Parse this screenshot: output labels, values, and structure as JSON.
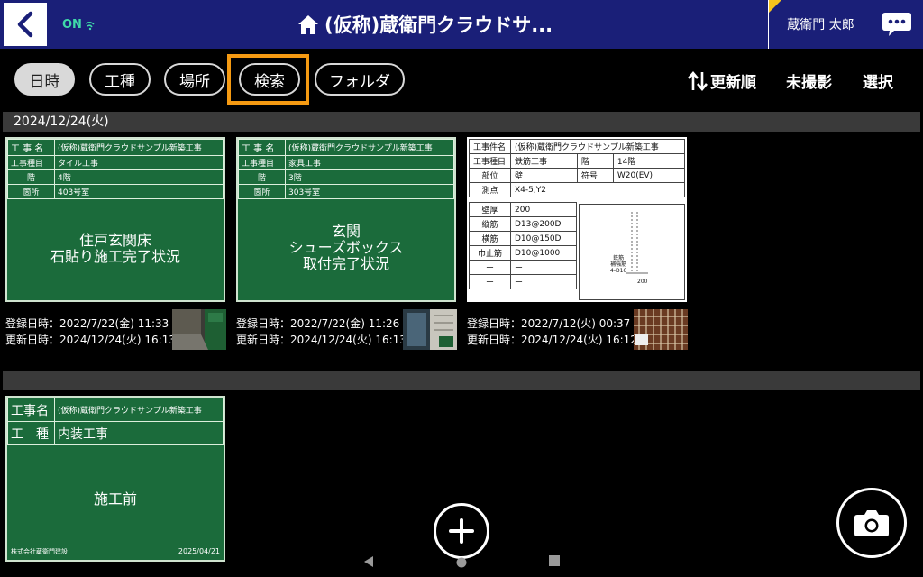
{
  "header": {
    "status": "ON",
    "title": "(仮称)蔵衛門クラウドサ...",
    "user": "蔵衛門 太郎"
  },
  "toolbar": {
    "tabs": [
      "日時",
      "工種",
      "場所",
      "検索",
      "フォルダ"
    ],
    "sort": "更新順",
    "unshot": "未撮影",
    "select": "選択"
  },
  "sections": [
    {
      "date": "2024/12/24(火)"
    },
    {
      "date": ""
    }
  ],
  "cards": [
    {
      "board": {
        "r1": [
          "工 事 名",
          "(仮称)蔵衛門クラウドサンプル新築工事"
        ],
        "r2": [
          "工事種目",
          "タイル工事"
        ],
        "r3": [
          "階",
          "4階"
        ],
        "r4": [
          "箇所",
          "403号室"
        ],
        "text1": "住戸玄関床",
        "text2": "石貼り施工完了状況"
      },
      "registered": "登録日時：2022/7/22(金) 11:33",
      "updated": "更新日時：2024/12/24(火) 16:13"
    },
    {
      "board": {
        "r1": [
          "工 事 名",
          "(仮称)蔵衛門クラウドサンプル新築工事"
        ],
        "r2": [
          "工事種目",
          "家具工事"
        ],
        "r3": [
          "階",
          "3階"
        ],
        "r4": [
          "箇所",
          "303号室"
        ],
        "text1": "玄関",
        "text2": "シューズボックス",
        "text3": "取付完了状況"
      },
      "registered": "登録日時：2022/7/22(金) 11:26",
      "updated": "更新日時：2024/12/24(火) 16:13"
    },
    {
      "board": {
        "r1": [
          "工事件名",
          "(仮称)蔵衛門クラウドサンプル新築工事"
        ],
        "r2": [
          "工事種目",
          "鉄筋工事",
          "階",
          "14階"
        ],
        "r3": [
          "部位",
          "壁",
          "符号",
          "W20(EV)"
        ],
        "r4": [
          "測点",
          "X4-5,Y2"
        ],
        "r5": [
          "壁厚",
          "200"
        ],
        "r6": [
          "縦筋",
          "D13@200D"
        ],
        "r7": [
          "横筋",
          "D10@150D"
        ],
        "r8": [
          "巾止筋",
          "D10@1000"
        ],
        "r9": [
          "ー",
          "ー"
        ],
        "r10": [
          "ー",
          "ー"
        ],
        "sketch_label1": "鉄筋",
        "sketch_label2": "補強筋",
        "sketch_label3": "4-D16",
        "sketch_dim": "200"
      },
      "registered": "登録日時：2022/7/12(火) 00:37",
      "updated": "更新日時：2024/12/24(火) 16:12"
    },
    {
      "board": {
        "r1": [
          "工事名",
          "(仮称)蔵衛門クラウドサンプル新築工事"
        ],
        "r2": [
          "工　種",
          "内装工事"
        ],
        "text1": "施工前",
        "company": "株式会社蔵衛門建設",
        "date": "2025/04/21"
      }
    }
  ],
  "colors": {
    "header_bg": "#1a1f78",
    "board_green": "#1b6b3b",
    "highlight": "#f59a12",
    "status_on": "#3fd9a9"
  },
  "icons": {
    "back": "chevron-left-icon",
    "home": "home-icon",
    "wifi": "wifi-icon",
    "chat": "chat-bubble-icon",
    "sort": "sort-arrows-icon",
    "add": "plus-icon",
    "camera": "camera-icon"
  }
}
